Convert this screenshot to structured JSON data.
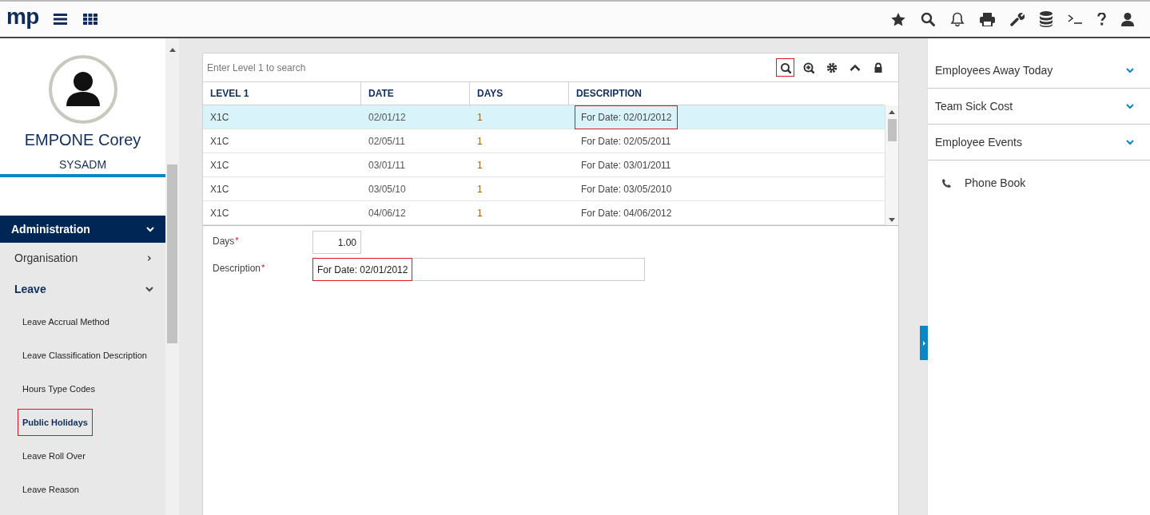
{
  "topbar": {
    "logo": "mp"
  },
  "profile": {
    "name": "EMPONE Corey",
    "role": "SYSADM"
  },
  "nav": [
    {
      "label": "Administration",
      "expanded": true,
      "children": [
        {
          "label": "Organisation",
          "expanded": false
        },
        {
          "label": "Leave",
          "expanded": true,
          "children": [
            {
              "label": "Leave Accrual Method",
              "selected": false,
              "highlighted": false
            },
            {
              "label": "Leave Classification Description",
              "selected": false,
              "highlighted": false
            },
            {
              "label": "Hours Type Codes",
              "selected": false,
              "highlighted": false
            },
            {
              "label": "Public Holidays",
              "selected": true,
              "highlighted": true
            },
            {
              "label": "Leave Roll Over",
              "selected": false,
              "highlighted": false
            },
            {
              "label": "Leave Reason",
              "selected": false,
              "highlighted": false
            }
          ]
        }
      ]
    }
  ],
  "grid": {
    "search": {
      "placeholder": "Enter Level 1 to search"
    },
    "tools": [
      {
        "kind": "search",
        "highlighted": true
      },
      {
        "kind": "zoom",
        "highlighted": false
      },
      {
        "kind": "settings",
        "highlighted": false
      },
      {
        "kind": "collapse",
        "highlighted": false
      },
      {
        "kind": "lock",
        "highlighted": false
      }
    ],
    "columns": [
      "LEVEL 1",
      "DATE",
      "DAYS",
      "DESCRIPTION"
    ],
    "rows": [
      {
        "cells": [
          "X1C",
          "02/01/12",
          "1",
          "For Date: 02/01/2012"
        ],
        "selected": true,
        "highlighted": true
      },
      {
        "cells": [
          "X1C",
          "02/05/11",
          "1",
          "For Date: 02/05/2011"
        ],
        "selected": false,
        "highlighted": false
      },
      {
        "cells": [
          "X1C",
          "03/01/11",
          "1",
          "For Date: 03/01/2011"
        ],
        "selected": false,
        "highlighted": false
      },
      {
        "cells": [
          "X1C",
          "03/05/10",
          "1",
          "For Date: 03/05/2010"
        ],
        "selected": false,
        "highlighted": false
      },
      {
        "cells": [
          "X1C",
          "04/06/12",
          "1",
          "For Date: 04/06/2012"
        ],
        "selected": false,
        "highlighted": false
      }
    ]
  },
  "form": [
    {
      "label": "Days",
      "required_marker": "*",
      "value": "1.00",
      "kind": "number",
      "highlighted": false
    },
    {
      "label": "Description",
      "required_marker": "*",
      "value": "For Date: 02/01/2012",
      "kind": "text",
      "highlighted": true
    }
  ],
  "widgets": [
    {
      "label": "Employees Away Today",
      "kind": "accordion"
    },
    {
      "label": "Team Sick Cost",
      "kind": "accordion"
    },
    {
      "label": "Employee Events",
      "kind": "accordion"
    },
    {
      "label": "Phone Book",
      "kind": "link"
    }
  ]
}
